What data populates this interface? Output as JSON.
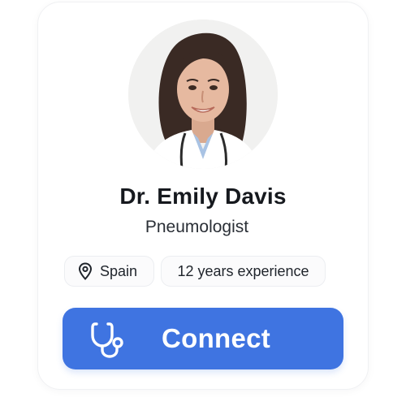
{
  "profile": {
    "name": "Dr. Emily Davis",
    "specialty": "Pneumologist"
  },
  "tags": {
    "location": "Spain",
    "experience": "12 years experience",
    "location_icon": "map-pin-icon"
  },
  "action": {
    "label": "Connect",
    "icon": "stethoscope-icon"
  },
  "colors": {
    "accent": "#3f74e1",
    "name_text": "#16191e",
    "chip_border": "#eceef1"
  }
}
